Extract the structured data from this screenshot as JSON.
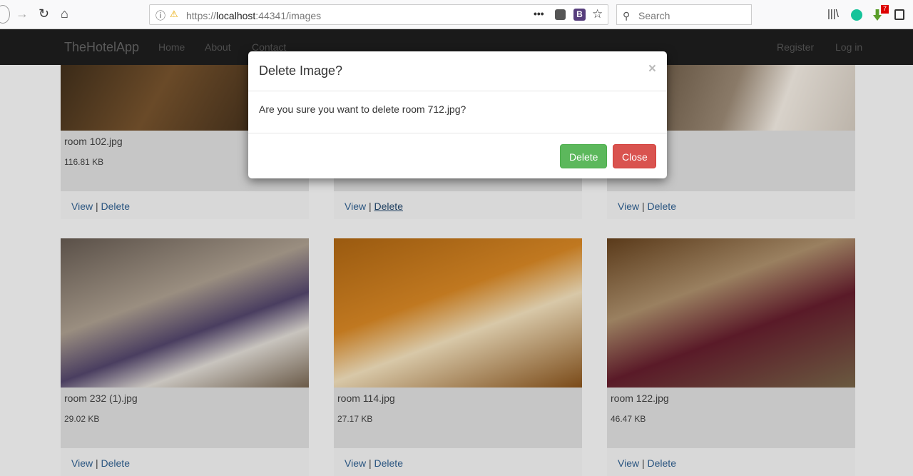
{
  "browser": {
    "url_prefix": "https://",
    "url_host": "localhost",
    "url_rest": ":44341/images",
    "search_placeholder": "Search",
    "badge": "7"
  },
  "navbar": {
    "brand": "TheHotelApp",
    "links": [
      "Home",
      "About",
      "Contact"
    ],
    "right": [
      "Register",
      "Log in"
    ]
  },
  "cards": [
    {
      "name": "room 102.jpg",
      "size": "116.81 KB"
    },
    {
      "name": "",
      "size": ""
    },
    {
      "name": "",
      "size": ""
    },
    {
      "name": "room 232 (1).jpg",
      "size": "29.02 KB"
    },
    {
      "name": "room 114.jpg",
      "size": "27.17 KB"
    },
    {
      "name": "room 122.jpg",
      "size": "46.47 KB"
    }
  ],
  "links": {
    "view": "View",
    "sep": "|",
    "delete": "Delete"
  },
  "modal": {
    "title": "Delete Image?",
    "close_x": "×",
    "body": "Are you sure you want to delete room 712.jpg?",
    "delete": "Delete",
    "close": "Close"
  },
  "colors": {
    "success": "#5cb85c",
    "danger": "#d9534f",
    "navbar": "#1a1a1a"
  }
}
